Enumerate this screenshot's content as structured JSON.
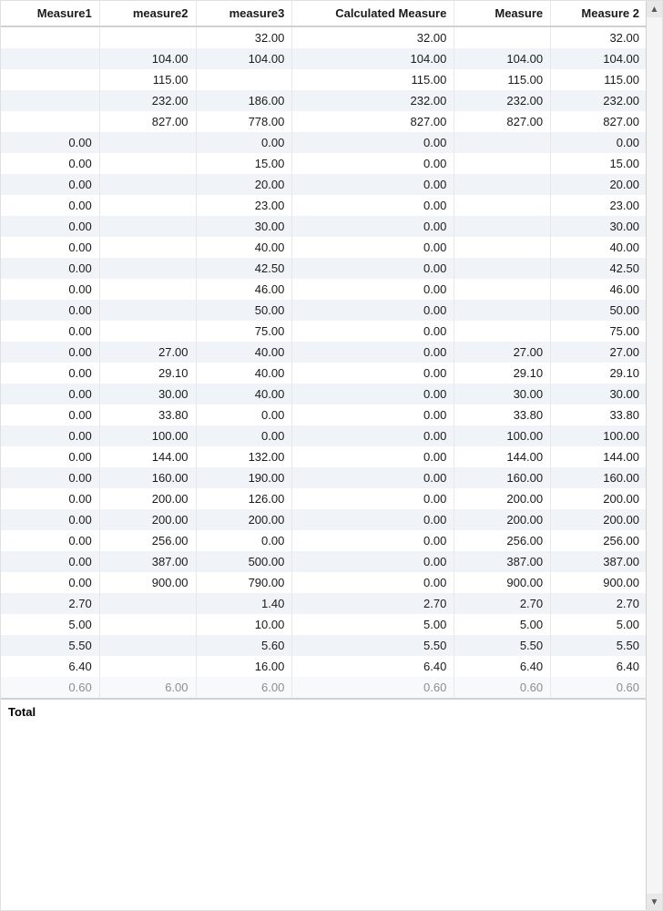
{
  "table": {
    "columns": [
      {
        "id": "c1",
        "label": "Measure1"
      },
      {
        "id": "c2",
        "label": "measure2"
      },
      {
        "id": "c3",
        "label": "measure3"
      },
      {
        "id": "c4",
        "label": "Calculated Measure"
      },
      {
        "id": "c5",
        "label": "Measure"
      },
      {
        "id": "c6",
        "label": "Measure 2"
      }
    ],
    "rows": [
      [
        "",
        "",
        "32.00",
        "32.00",
        "",
        "32.00"
      ],
      [
        "",
        "104.00",
        "104.00",
        "104.00",
        "104.00",
        "104.00"
      ],
      [
        "",
        "115.00",
        "",
        "115.00",
        "115.00",
        "115.00"
      ],
      [
        "",
        "232.00",
        "186.00",
        "232.00",
        "232.00",
        "232.00"
      ],
      [
        "",
        "827.00",
        "778.00",
        "827.00",
        "827.00",
        "827.00"
      ],
      [
        "0.00",
        "",
        "0.00",
        "0.00",
        "",
        "0.00"
      ],
      [
        "0.00",
        "",
        "15.00",
        "0.00",
        "",
        "15.00"
      ],
      [
        "0.00",
        "",
        "20.00",
        "0.00",
        "",
        "20.00"
      ],
      [
        "0.00",
        "",
        "23.00",
        "0.00",
        "",
        "23.00"
      ],
      [
        "0.00",
        "",
        "30.00",
        "0.00",
        "",
        "30.00"
      ],
      [
        "0.00",
        "",
        "40.00",
        "0.00",
        "",
        "40.00"
      ],
      [
        "0.00",
        "",
        "42.50",
        "0.00",
        "",
        "42.50"
      ],
      [
        "0.00",
        "",
        "46.00",
        "0.00",
        "",
        "46.00"
      ],
      [
        "0.00",
        "",
        "50.00",
        "0.00",
        "",
        "50.00"
      ],
      [
        "0.00",
        "",
        "75.00",
        "0.00",
        "",
        "75.00"
      ],
      [
        "0.00",
        "27.00",
        "40.00",
        "0.00",
        "27.00",
        "27.00"
      ],
      [
        "0.00",
        "29.10",
        "40.00",
        "0.00",
        "29.10",
        "29.10"
      ],
      [
        "0.00",
        "30.00",
        "40.00",
        "0.00",
        "30.00",
        "30.00"
      ],
      [
        "0.00",
        "33.80",
        "0.00",
        "0.00",
        "33.80",
        "33.80"
      ],
      [
        "0.00",
        "100.00",
        "0.00",
        "0.00",
        "100.00",
        "100.00"
      ],
      [
        "0.00",
        "144.00",
        "132.00",
        "0.00",
        "144.00",
        "144.00"
      ],
      [
        "0.00",
        "160.00",
        "190.00",
        "0.00",
        "160.00",
        "160.00"
      ],
      [
        "0.00",
        "200.00",
        "126.00",
        "0.00",
        "200.00",
        "200.00"
      ],
      [
        "0.00",
        "200.00",
        "200.00",
        "0.00",
        "200.00",
        "200.00"
      ],
      [
        "0.00",
        "256.00",
        "0.00",
        "0.00",
        "256.00",
        "256.00"
      ],
      [
        "0.00",
        "387.00",
        "500.00",
        "0.00",
        "387.00",
        "387.00"
      ],
      [
        "0.00",
        "900.00",
        "790.00",
        "0.00",
        "900.00",
        "900.00"
      ],
      [
        "2.70",
        "",
        "1.40",
        "2.70",
        "2.70",
        "2.70"
      ],
      [
        "5.00",
        "",
        "10.00",
        "5.00",
        "5.00",
        "5.00"
      ],
      [
        "5.50",
        "",
        "5.60",
        "5.50",
        "5.50",
        "5.50"
      ],
      [
        "6.40",
        "",
        "16.00",
        "6.40",
        "6.40",
        "6.40"
      ],
      [
        "0.60",
        "6.00",
        "6.00",
        "0.60",
        "0.60",
        "0.60"
      ]
    ],
    "footer": {
      "label": "Total"
    },
    "scroll_up": "▲",
    "scroll_down": "▼"
  }
}
